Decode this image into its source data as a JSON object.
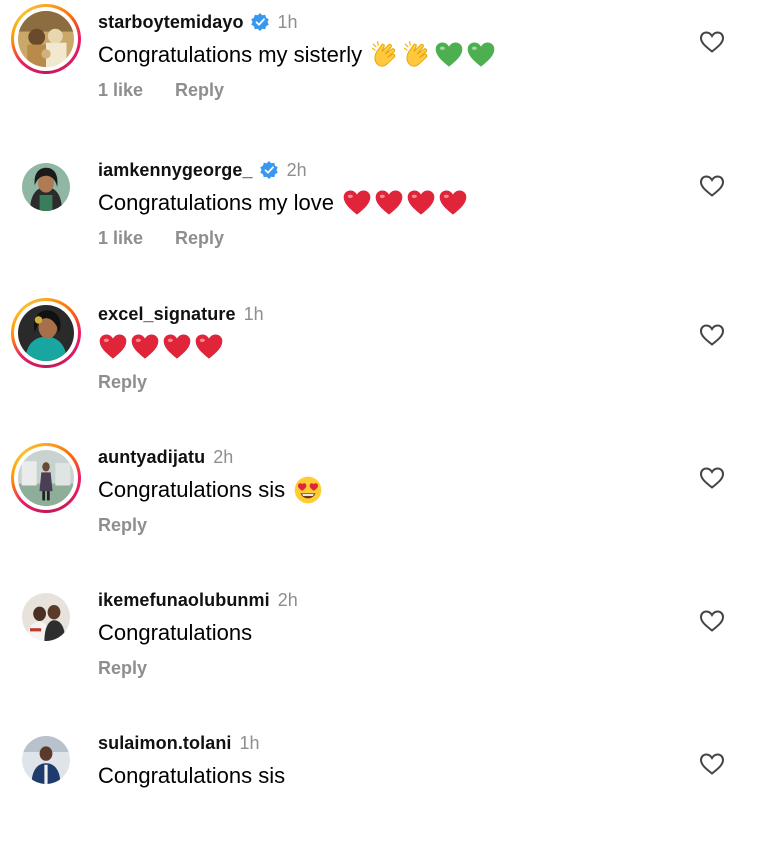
{
  "comments": [
    {
      "username": "starboytemidayo",
      "verified": true,
      "time": "1h",
      "text": "Congratulations my sisterly",
      "emojis": [
        "clapping-hands",
        "clapping-hands",
        "green-heart",
        "green-heart"
      ],
      "likes": "1 like",
      "reply": "Reply",
      "story_ring": true
    },
    {
      "username": "iamkennygeorge_",
      "verified": true,
      "time": "2h",
      "text": "Congratulations my love",
      "emojis": [
        "red-heart",
        "red-heart",
        "red-heart",
        "red-heart"
      ],
      "likes": "1 like",
      "reply": "Reply",
      "story_ring": false
    },
    {
      "username": "excel_signature",
      "verified": false,
      "time": "1h",
      "text": "",
      "emojis": [
        "red-heart",
        "red-heart",
        "red-heart",
        "red-heart"
      ],
      "likes": "",
      "reply": "Reply",
      "story_ring": true
    },
    {
      "username": "auntyadijatu",
      "verified": false,
      "time": "2h",
      "text": "Congratulations sis",
      "emojis": [
        "heart-eyes-face"
      ],
      "likes": "",
      "reply": "Reply",
      "story_ring": true
    },
    {
      "username": "ikemefunaolubunmi",
      "verified": false,
      "time": "2h",
      "text": "Congratulations",
      "emojis": [],
      "likes": "",
      "reply": "Reply",
      "story_ring": false
    },
    {
      "username": "sulaimon.tolani",
      "verified": false,
      "time": "1h",
      "text": "Congratulations sis",
      "emojis": [],
      "likes": "",
      "reply": "",
      "story_ring": false
    }
  ],
  "colors": {
    "verified_blue": "#3897f0",
    "secondary_text": "#8e8e8e",
    "red_heart": "#e0245e",
    "green_heart": "#4caf50"
  },
  "icons": {
    "like": "heart-outline-icon",
    "verified": "verified-badge-icon"
  }
}
